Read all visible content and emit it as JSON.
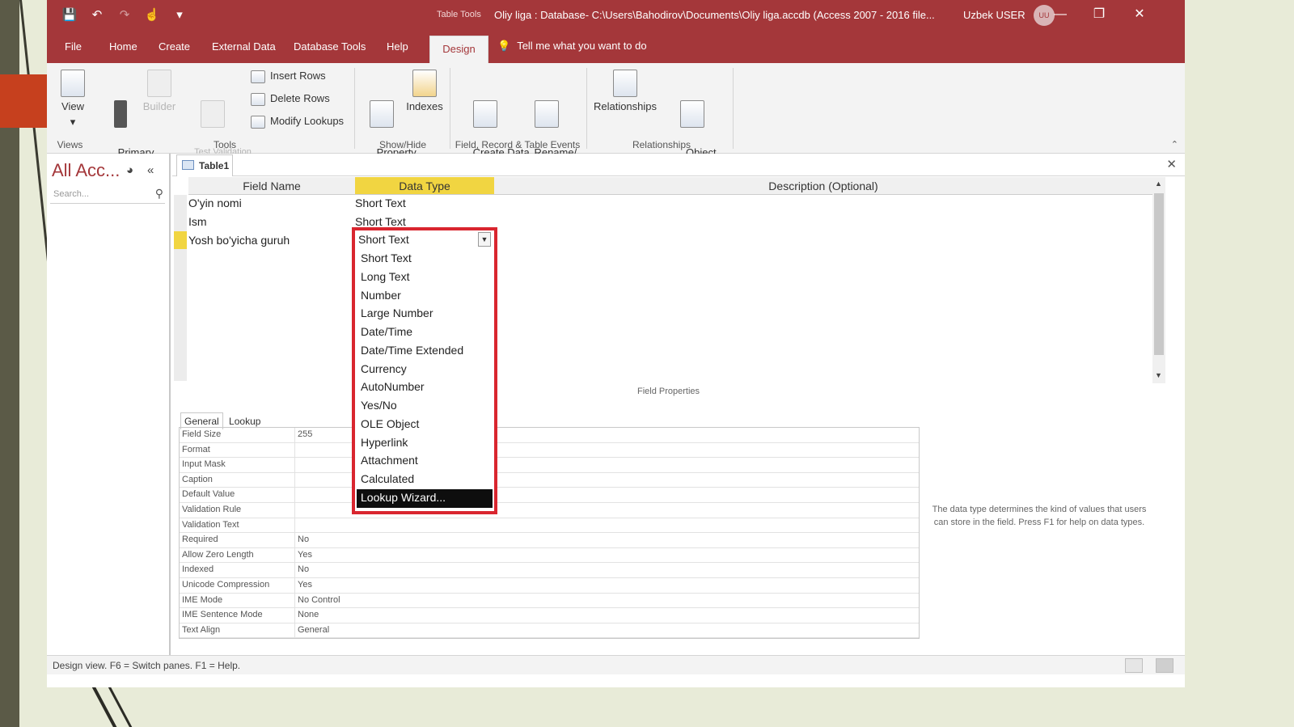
{
  "titlebar": {
    "qat_icons": [
      "save-icon",
      "undo-icon",
      "redo-icon",
      "touch-icon",
      "customize-icon"
    ],
    "table_tools_label": "Table Tools",
    "title": "Oliy liga : Database- C:\\Users\\Bahodirov\\Documents\\Oliy liga.accdb (Access 2007 - 2016 file...",
    "user": "Uzbek USER",
    "avatar": "UU"
  },
  "menu": {
    "file": "File",
    "home": "Home",
    "create": "Create",
    "external": "External Data",
    "dbtools": "Database Tools",
    "help": "Help",
    "design": "Design",
    "tellme": "Tell me what you want to do"
  },
  "ribbon": {
    "view": "View",
    "primary_key": "Primary\nKey",
    "builder": "Builder",
    "test_rules": "Test Validation\nRules",
    "insert_rows": "Insert Rows",
    "delete_rows": "Delete Rows",
    "modify_lookups": "Modify Lookups",
    "property_sheet": "Property\nSheet",
    "indexes": "Indexes",
    "create_macros": "Create Data\nMacros",
    "rename_macro": "Rename/\nDelete Macro",
    "relationships": "Relationships",
    "object_deps": "Object\nDependencies",
    "groups": {
      "views": "Views",
      "tools": "Tools",
      "showhide": "Show/Hide",
      "events": "Field, Record & Table Events",
      "relationships": "Relationships"
    }
  },
  "nav": {
    "title": "All Acc...",
    "search_placeholder": "Search..."
  },
  "doc": {
    "tab": "Table1",
    "headers": {
      "field_name": "Field Name",
      "data_type": "Data Type",
      "description": "Description (Optional)"
    },
    "rows": [
      {
        "field": "O'yin nomi",
        "type": "Short Text"
      },
      {
        "field": "Ism",
        "type": "Short Text"
      },
      {
        "field": "Yosh bo'yicha guruh",
        "type": "Short Text"
      }
    ],
    "field_properties_label": "Field Properties",
    "prop_tabs": {
      "general": "General",
      "lookup": "Lookup"
    },
    "props": [
      {
        "name": "Field Size",
        "value": "255"
      },
      {
        "name": "Format",
        "value": ""
      },
      {
        "name": "Input Mask",
        "value": ""
      },
      {
        "name": "Caption",
        "value": ""
      },
      {
        "name": "Default Value",
        "value": ""
      },
      {
        "name": "Validation Rule",
        "value": ""
      },
      {
        "name": "Validation Text",
        "value": ""
      },
      {
        "name": "Required",
        "value": "No"
      },
      {
        "name": "Allow Zero Length",
        "value": "Yes"
      },
      {
        "name": "Indexed",
        "value": "No"
      },
      {
        "name": "Unicode Compression",
        "value": "Yes"
      },
      {
        "name": "IME Mode",
        "value": "No Control"
      },
      {
        "name": "IME Sentence Mode",
        "value": "None"
      },
      {
        "name": "Text Align",
        "value": "General"
      }
    ],
    "help": "The data type determines the kind of values that users can store in the field. Press F1 for help on data types."
  },
  "combo": {
    "value": "Short Text",
    "options": [
      "Short Text",
      "Long Text",
      "Number",
      "Large Number",
      "Date/Time",
      "Date/Time Extended",
      "Currency",
      "AutoNumber",
      "Yes/No",
      "OLE Object",
      "Hyperlink",
      "Attachment",
      "Calculated",
      "Lookup Wizard..."
    ],
    "selected_index": 13
  },
  "status": {
    "text": "Design view.  F6 = Switch panes.  F1 = Help."
  },
  "colors": {
    "accent": "#a4373a",
    "highlight": "#f1d541",
    "combo_border": "#d9262f"
  }
}
